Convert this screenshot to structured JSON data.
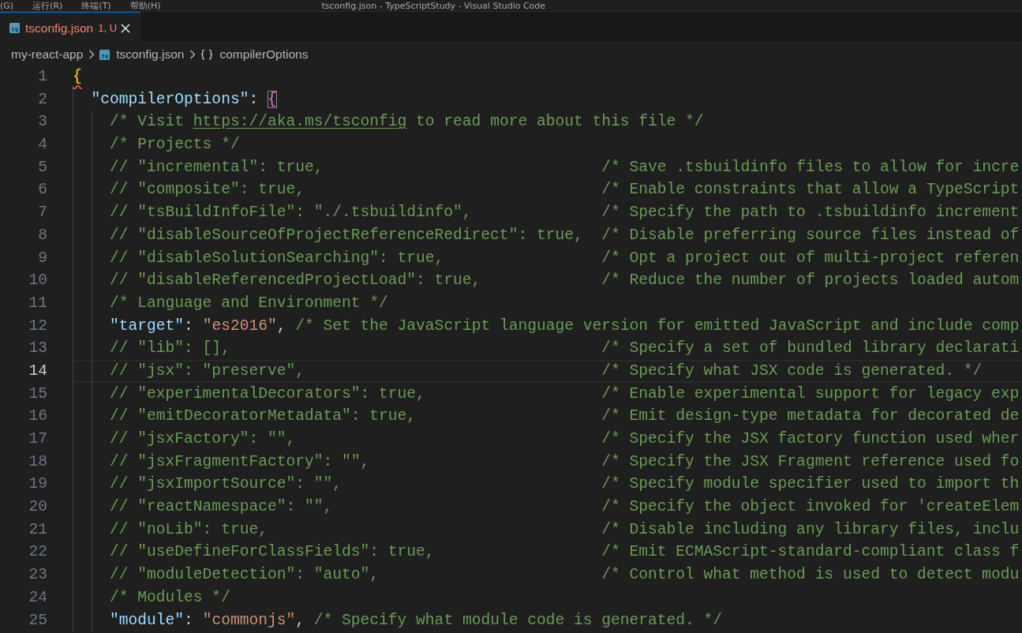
{
  "title_bar": {
    "menu": [
      "(G)",
      "运行(R)",
      "终端(T)",
      "帮助(H)"
    ],
    "title": "tsconfig.json - TypeScriptStudy - Visual Studio Code"
  },
  "tabs": [
    {
      "label": "tsconfig.json",
      "status": "1, U",
      "selected": true,
      "has_errors": true
    }
  ],
  "breadcrumb": [
    {
      "kind": "folder",
      "label": "my-react-app"
    },
    {
      "kind": "file",
      "label": "tsconfig.json"
    },
    {
      "kind": "object",
      "label": "compilerOptions"
    }
  ],
  "editor": {
    "lines": [
      {
        "number": "1",
        "current": false,
        "kind": "code",
        "tokens": [
          {
            "kind": "bracket",
            "text": "{",
            "color": "#ffd700",
            "error": true,
            "matched": false
          }
        ],
        "children": [
          {
            "number": "2",
            "current": false,
            "kind": "code",
            "tokens": [
              {
                "kind": "key",
                "text": "\"compilerOptions\""
              },
              {
                "kind": "punct",
                "text": ": "
              },
              {
                "kind": "bracket",
                "text": "{",
                "color": "#da70d6",
                "error": false,
                "matched": true
              }
            ],
            "children": [
              {
                "number": "3",
                "current": false,
                "kind": "comment",
                "parts": [
                  {
                    "text": "/* Visit ",
                    "link": false
                  },
                  {
                    "text": "https://aka.ms/tsconfig",
                    "link": true
                  },
                  {
                    "text": " to read more about this file */",
                    "link": false
                  }
                ]
              },
              {
                "number": "4",
                "current": false,
                "kind": "comment",
                "parts": [
                  {
                    "text": "/* Projects */",
                    "link": false
                  }
                ]
              },
              {
                "number": "5",
                "current": false,
                "kind": "option",
                "option": "// \"incremental\": true,",
                "note": "/* Save .tsbuildinfo files to allow for incre"
              },
              {
                "number": "6",
                "current": false,
                "kind": "option",
                "option": "// \"composite\": true,",
                "note": "/* Enable constraints that allow a TypeScript"
              },
              {
                "number": "7",
                "current": false,
                "kind": "option",
                "option": "// \"tsBuildInfoFile\": \"./.tsbuildinfo\",",
                "note": "/* Specify the path to .tsbuildinfo increment"
              },
              {
                "number": "8",
                "current": false,
                "kind": "option",
                "option": "// \"disableSourceOfProjectReferenceRedirect\": true,",
                "note": "/* Disable preferring source files instead of"
              },
              {
                "number": "9",
                "current": false,
                "kind": "option",
                "option": "// \"disableSolutionSearching\": true,",
                "note": "/* Opt a project out of multi-project referen"
              },
              {
                "number": "10",
                "current": false,
                "kind": "option",
                "option": "// \"disableReferencedProjectLoad\": true,",
                "note": "/* Reduce the number of projects loaded autom"
              },
              {
                "number": "11",
                "current": false,
                "kind": "comment",
                "parts": [
                  {
                    "text": "/* Language and Environment */",
                    "link": false
                  }
                ]
              },
              {
                "number": "12",
                "current": false,
                "kind": "code",
                "tokens": [
                  {
                    "kind": "key",
                    "text": "\"target\""
                  },
                  {
                    "kind": "punct",
                    "text": ": "
                  },
                  {
                    "kind": "string",
                    "text": "\"es2016\""
                  },
                  {
                    "kind": "punct",
                    "text": ", "
                  },
                  {
                    "kind": "comment",
                    "text": "/* Set the JavaScript language version for emitted JavaScript and include comp"
                  }
                ]
              },
              {
                "number": "13",
                "current": false,
                "kind": "option",
                "option": "// \"lib\": [],",
                "note": "/* Specify a set of bundled library declarati"
              },
              {
                "number": "14",
                "current": true,
                "kind": "option",
                "option": "// \"jsx\": \"preserve\",",
                "note": "/* Specify what JSX code is generated. */"
              },
              {
                "number": "15",
                "current": false,
                "kind": "option",
                "option": "// \"experimentalDecorators\": true,",
                "note": "/* Enable experimental support for legacy exp"
              },
              {
                "number": "16",
                "current": false,
                "kind": "option",
                "option": "// \"emitDecoratorMetadata\": true,",
                "note": "/* Emit design-type metadata for decorated de"
              },
              {
                "number": "17",
                "current": false,
                "kind": "option",
                "option": "// \"jsxFactory\": \"\",",
                "note": "/* Specify the JSX factory function used wher"
              },
              {
                "number": "18",
                "current": false,
                "kind": "option",
                "option": "// \"jsxFragmentFactory\": \"\",",
                "note": "/* Specify the JSX Fragment reference used fo"
              },
              {
                "number": "19",
                "current": false,
                "kind": "option",
                "option": "// \"jsxImportSource\": \"\",",
                "note": "/* Specify module specifier used to import th"
              },
              {
                "number": "20",
                "current": false,
                "kind": "option",
                "option": "// \"reactNamespace\": \"\",",
                "note": "/* Specify the object invoked for 'createElem"
              },
              {
                "number": "21",
                "current": false,
                "kind": "option",
                "option": "// \"noLib\": true,",
                "note": "/* Disable including any library files, inclu"
              },
              {
                "number": "22",
                "current": false,
                "kind": "option",
                "option": "// \"useDefineForClassFields\": true,",
                "note": "/* Emit ECMAScript-standard-compliant class f"
              },
              {
                "number": "23",
                "current": false,
                "kind": "option",
                "option": "// \"moduleDetection\": \"auto\",",
                "note": "/* Control what method is used to detect modu"
              },
              {
                "number": "24",
                "current": false,
                "kind": "comment",
                "parts": [
                  {
                    "text": "/* Modules */",
                    "link": false
                  }
                ]
              },
              {
                "number": "25",
                "current": false,
                "kind": "code",
                "tokens": [
                  {
                    "kind": "key",
                    "text": "\"module\""
                  },
                  {
                    "kind": "punct",
                    "text": ": "
                  },
                  {
                    "kind": "string",
                    "text": "\"commonjs\""
                  },
                  {
                    "kind": "punct",
                    "text": ", "
                  },
                  {
                    "kind": "comment",
                    "text": "/* Specify what module code is generated. */"
                  }
                ]
              }
            ]
          }
        ]
      }
    ]
  }
}
